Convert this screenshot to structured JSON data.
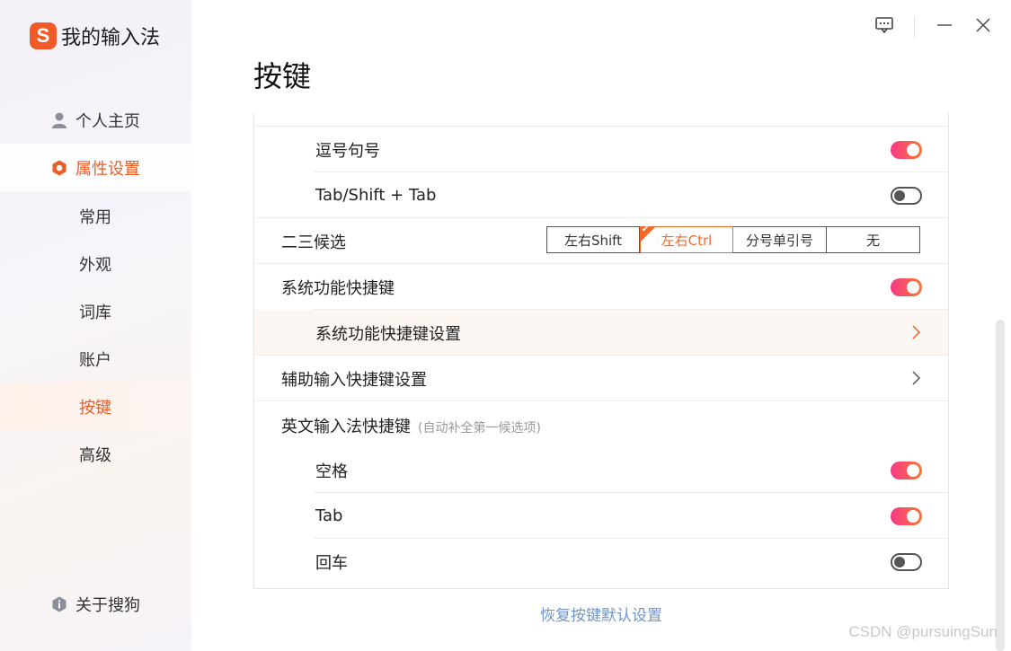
{
  "app": {
    "logo_letter": "S",
    "title": "我的输入法",
    "accent": "#ef5b26"
  },
  "sidebar": {
    "sections": [
      {
        "label": "个人主页",
        "icon": "person-icon",
        "active": false
      },
      {
        "label": "属性设置",
        "icon": "hexagon-settings-icon",
        "active": true
      }
    ],
    "subitems": [
      {
        "label": "常用",
        "active": false
      },
      {
        "label": "外观",
        "active": false
      },
      {
        "label": "词库",
        "active": false
      },
      {
        "label": "账户",
        "active": false
      },
      {
        "label": "按键",
        "active": true
      },
      {
        "label": "高级",
        "active": false
      }
    ],
    "about": {
      "label": "关于搜狗",
      "icon": "info-shield-icon"
    }
  },
  "page": {
    "title": "按键"
  },
  "rows": {
    "comma_period": {
      "label": "逗号句号",
      "toggle": "on"
    },
    "tab_shift_tab": {
      "label": "Tab/Shift + Tab",
      "toggle": "off"
    },
    "second_third_candidate": {
      "label": "二三候选",
      "options": [
        "左右Shift",
        "左右Ctrl",
        "分号单引号",
        "无"
      ],
      "selected": "左右Ctrl"
    },
    "system_shortcuts": {
      "label": "系统功能快捷键",
      "toggle": "on"
    },
    "system_shortcut_settings": {
      "label": "系统功能快捷键设置"
    },
    "assist_input_shortcut": {
      "label": "辅助输入快捷键设置"
    },
    "english_shortcut": {
      "label": "英文输入法快捷键",
      "hint": "(自动补全第一候选项)"
    },
    "space": {
      "label": "空格",
      "toggle": "on"
    },
    "tab": {
      "label": "Tab",
      "toggle": "on"
    },
    "enter": {
      "label": "回车",
      "toggle": "off"
    }
  },
  "footer": {
    "restore_label": "恢复按键默认设置"
  },
  "watermark": "CSDN @pursuingSun"
}
